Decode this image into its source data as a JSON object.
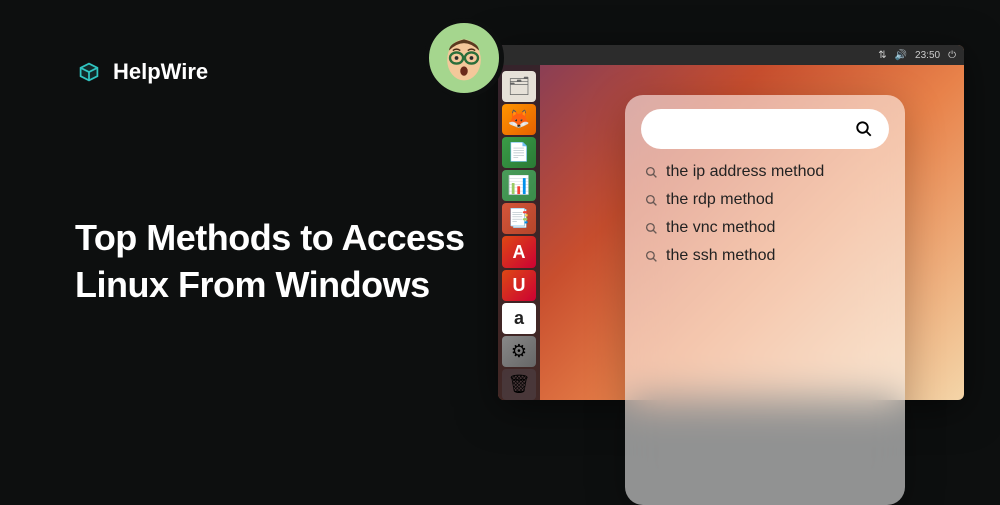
{
  "brand": {
    "name": "HelpWire"
  },
  "headline": {
    "line1": "Top Methods to Access",
    "line2": "Linux From Windows"
  },
  "topbar": {
    "time": "23:50"
  },
  "launcher": {
    "items": [
      {
        "glyph": "🗂"
      },
      {
        "glyph": "🦊"
      },
      {
        "glyph": "📄"
      },
      {
        "glyph": "📊"
      },
      {
        "glyph": "📑"
      },
      {
        "glyph": "A"
      },
      {
        "glyph": "U"
      },
      {
        "glyph": "a"
      },
      {
        "glyph": "⚙"
      },
      {
        "glyph": "🗑"
      }
    ]
  },
  "search": {
    "suggestions": [
      {
        "text": "the ip address method"
      },
      {
        "text": "the rdp method"
      },
      {
        "text": "the vnc method"
      },
      {
        "text": "the ssh method"
      }
    ]
  }
}
